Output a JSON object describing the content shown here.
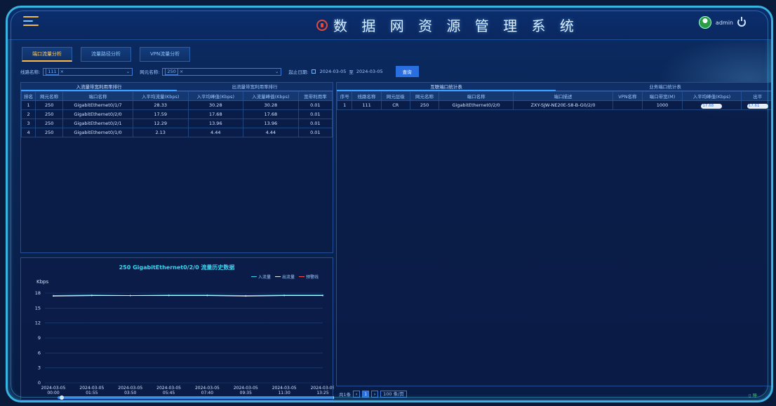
{
  "header": {
    "title": "数 据 网 资 源 管 理 系 统",
    "username": "admin"
  },
  "tabs": [
    "端口流量分析",
    "流量路径分析",
    "VPN流量分析"
  ],
  "filters": {
    "line_label": "线路名称:",
    "line_value": "111",
    "ne_label": "网元名称:",
    "ne_value": "250",
    "date_label": "起止日期:",
    "date_start": "2024-03-05",
    "date_sep": "至",
    "date_end": "2024-03-05",
    "query_label": "查询"
  },
  "left_panel": {
    "tabs": [
      "入流量带宽利用率排行",
      "出流量带宽利用率排行"
    ],
    "columns": [
      "排名",
      "网元名称",
      "端口名称",
      "入平均流量(Kbps)",
      "入平均峰值(Kbps)",
      "入流量峰值(Kbps)",
      "宽带利用率"
    ],
    "rows": [
      [
        "1",
        "250",
        "GigabitEthernet0/1/7",
        "28.33",
        "30.28",
        "30.28",
        "0.01"
      ],
      [
        "2",
        "250",
        "GigabitEthernet0/2/0",
        "17.59",
        "17.68",
        "17.68",
        "0.01"
      ],
      [
        "3",
        "250",
        "GigabitEthernet0/2/1",
        "12.29",
        "13.96",
        "13.96",
        "0.01"
      ],
      [
        "4",
        "250",
        "GigabitEthernet0/1/0",
        "2.13",
        "4.44",
        "4.44",
        "0.01"
      ]
    ]
  },
  "right_panel": {
    "tabs": [
      "互联端口统计表",
      "业务端口统计表"
    ],
    "columns": [
      "序号",
      "线路名称",
      "网元层级",
      "网元名称",
      "端口名称",
      "端口描述",
      "VPN名称",
      "端口带宽(M)",
      "入平均峰值(Kbps)",
      "出平"
    ],
    "rows": [
      [
        "1",
        "111",
        "CR",
        "250",
        "GigabitEthernet0/2/0",
        "ZXY-SJW-NE20E-S8-B-G0/2/0",
        "",
        "1000",
        "17.68",
        "17.61"
      ]
    ]
  },
  "pager": {
    "total": "共1条",
    "page": "1",
    "page_size": "100 条/页"
  },
  "export_label": "导",
  "chart_data": {
    "type": "line",
    "title": "250 GigabitEthernet0/2/0 流量历史数据",
    "ylabel": "Kbps",
    "ylim": [
      0,
      18
    ],
    "yticks": [
      0,
      3,
      6,
      9,
      12,
      15,
      18
    ],
    "xticks": [
      "2024-03-05 00:00",
      "2024-03-05 01:55",
      "2024-03-05 03:50",
      "2024-03-05 05:45",
      "2024-03-05 07:40",
      "2024-03-05 09:35",
      "2024-03-05 11:30",
      "2024-03-05 13:25"
    ],
    "series": [
      {
        "name": "入流量",
        "color": "#3fd2f0",
        "values": [
          17.5,
          17.6,
          17.5,
          17.6,
          17.6,
          17.5,
          17.6,
          17.6
        ]
      },
      {
        "name": "出流量",
        "color": "#e8eef7",
        "values": [
          17.4,
          17.5,
          17.5,
          17.5,
          17.5,
          17.4,
          17.5,
          17.5
        ]
      },
      {
        "name": "预警线",
        "color": "#ff4d4d",
        "values": []
      }
    ]
  }
}
